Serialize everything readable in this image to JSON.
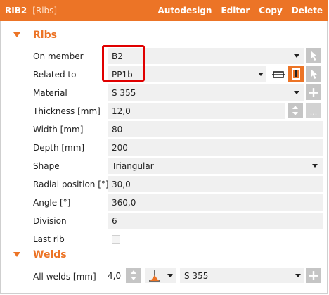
{
  "titlebar": {
    "name": "RIB2",
    "subtitle": "[Ribs]",
    "actions": [
      "Autodesign",
      "Editor",
      "Copy",
      "Delete"
    ]
  },
  "ribs": {
    "section_title": "Ribs",
    "on_member": {
      "label": "On member",
      "value": "B2"
    },
    "related_to": {
      "label": "Related to",
      "value": "PP1b"
    },
    "material": {
      "label": "Material",
      "value": "S 355"
    },
    "thickness": {
      "label": "Thickness [mm]",
      "value": "12,0"
    },
    "width": {
      "label": "Width [mm]",
      "value": "80"
    },
    "depth": {
      "label": "Depth [mm]",
      "value": "200"
    },
    "shape": {
      "label": "Shape",
      "value": "Triangular"
    },
    "radial_position": {
      "label": "Radial position [°]",
      "value": "30,0"
    },
    "angle": {
      "label": "Angle [°]",
      "value": "360,0"
    },
    "division": {
      "label": "Division",
      "value": "6"
    },
    "last_rib": {
      "label": "Last rib",
      "checked": false
    }
  },
  "welds": {
    "section_title": "Welds",
    "all_welds": {
      "label": "All welds [mm]",
      "value": "4,0",
      "material": "S 355"
    }
  },
  "colors": {
    "accent": "#ec7426",
    "highlight": "#e00000",
    "button_gray": "#c5c5c5",
    "field_bg": "#f0f0f0"
  }
}
